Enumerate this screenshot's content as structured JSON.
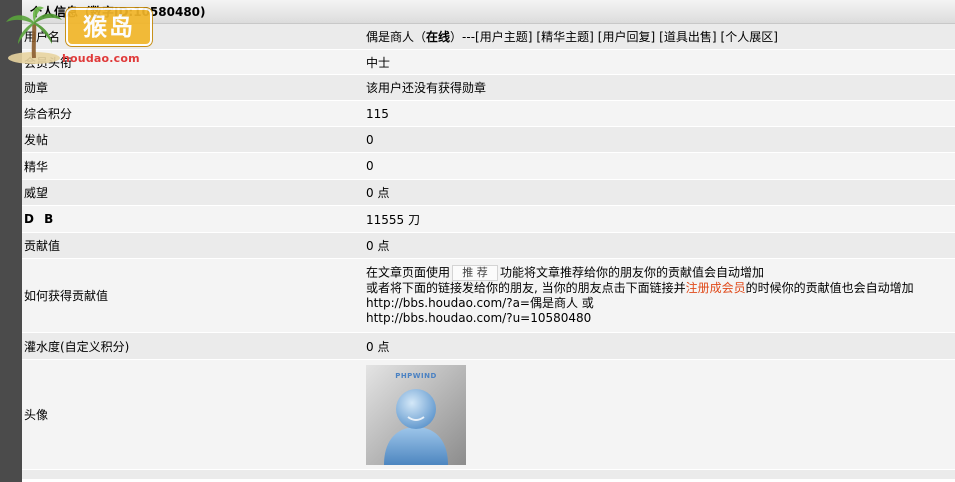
{
  "header": {
    "title": "个人信息（数字ID:10580480)"
  },
  "logo": {
    "brand_text": "猴岛",
    "url_text": "houdao.com"
  },
  "profile": {
    "username": {
      "label": "用户名",
      "name": "偶是商人",
      "status_open": "（",
      "status": "在线",
      "status_close": "）---",
      "links": [
        "[用户主题]",
        "[精华主题]",
        "[用户回复]",
        "[道具出售]",
        "[个人展区]"
      ]
    },
    "rank": {
      "label": "会员头衔",
      "value": "中士"
    },
    "medal": {
      "label": "勋章",
      "value": "该用户还没有获得勋章"
    },
    "score": {
      "label": "综合积分",
      "value": "115"
    },
    "posts": {
      "label": "发帖",
      "value": "0"
    },
    "digest": {
      "label": "精华",
      "value": "0"
    },
    "prestige": {
      "label": "威望",
      "value": "0 点"
    },
    "db": {
      "label": "D B",
      "value": "11555 刀"
    },
    "contribution": {
      "label": "贡献值",
      "value": "0 点"
    },
    "how_to_contribute": {
      "label": "如何获得贡献值",
      "line1_pre": "在文章页面使用",
      "recommend_button": "推 荐",
      "line1_post": "功能将文章推荐给你的朋友你的贡献值会自动增加",
      "line2_pre": "或者将下面的链接发给你的朋友, 当你的朋友点击下面链接并",
      "register_link": "注册成会员",
      "line2_post": "的时候你的贡献值也会自动增加",
      "link1": "http://bbs.houdao.com/?a=偶是商人 或",
      "link2": "http://bbs.houdao.com/?u=10580480"
    },
    "water": {
      "label": "灌水度(自定义积分)",
      "value": "0 点"
    },
    "avatar": {
      "label": "头像",
      "brand": "PHPWIND"
    }
  },
  "colors": {
    "row_odd": "#ebebeb",
    "row_even": "#f4f4f4",
    "left_rail": "#4b4b4b",
    "register_link": "#e04a1a",
    "logo_orange": "#f2b629",
    "logo_red": "#e03a3a"
  }
}
